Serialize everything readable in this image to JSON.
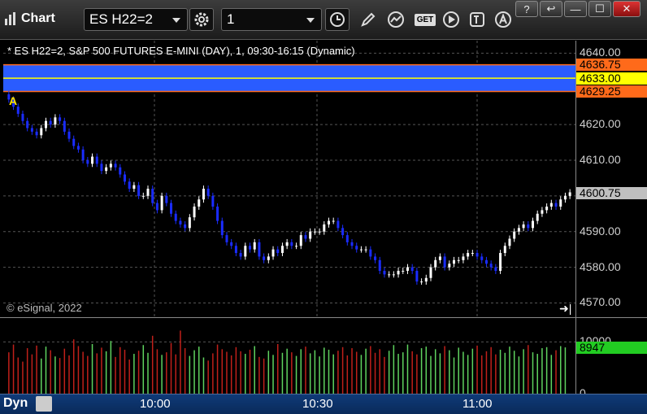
{
  "toolbar": {
    "app_title": "Chart",
    "symbol_value": "ES H22=2",
    "interval_value": "1",
    "buttons": [
      "settings-icon",
      "clock-icon",
      "pencil-icon",
      "study-icon",
      "get-icon",
      "play-icon",
      "text-tool-icon",
      "alert-icon"
    ],
    "get_label": "GET",
    "window_buttons": {
      "help": "?",
      "restore": "↩",
      "minimize": "—",
      "maximize": "☐",
      "close": "✕"
    }
  },
  "chart": {
    "title": "* ES H22=2, S&P 500 FUTURES E-MINI (DAY), 1, 09:30-16:15 (Dynamic)",
    "copyright": "© eSignal, 2022",
    "marker_text": "A",
    "goto_end_glyph": "➜|"
  },
  "price_axis": {
    "ticks": [
      "4640.00",
      "4620.00",
      "4610.00",
      "4600.00",
      "4590.00",
      "4580.00",
      "4570.00"
    ],
    "badges": {
      "upper": {
        "text": "4636.75",
        "color": "#ff6a1a"
      },
      "mid": {
        "text": "4633.00",
        "color": "#ffff00"
      },
      "lower": {
        "text": "4629.25",
        "color": "#ff6a1a"
      },
      "last": {
        "text": "4600.75",
        "color": "#bfbfbf"
      }
    }
  },
  "volume_axis": {
    "ticks": [
      "10000",
      "0"
    ],
    "last_volume": {
      "text": "8947",
      "color": "#22cc22"
    }
  },
  "time_axis": {
    "mode_label": "Dyn",
    "labels": [
      "10:00",
      "10:30",
      "11:00"
    ]
  },
  "colors": {
    "up_candle": "#ffffff",
    "down_candle": "#1a2cff",
    "band_fill": "#2a5cff",
    "band_edge": "#ff6a1a",
    "band_mid": "#ffff00",
    "volume_up": "#5fd35f",
    "volume_down": "#c0201a",
    "grid": "#555555"
  },
  "chart_data": {
    "type": "candlestick",
    "y_range": [
      4566.0,
      4643.5
    ],
    "price_levels": {
      "band_top": 4636.75,
      "band_mid": 4633.0,
      "band_bottom": 4629.25,
      "last": 4600.75
    },
    "closes": [
      4627,
      4625,
      4623,
      4621,
      4619,
      4618,
      4617,
      4619,
      4621,
      4620,
      4622,
      4621,
      4618,
      4616,
      4614,
      4613,
      4610,
      4609,
      4611,
      4609,
      4607,
      4608,
      4609,
      4608,
      4606,
      4604,
      4602,
      4603,
      4600,
      4600,
      4602,
      4598,
      4596,
      4600,
      4598,
      4595,
      4593,
      4592,
      4591,
      4594,
      4597,
      4599,
      4602,
      4600,
      4597,
      4593,
      4589,
      4587,
      4586,
      4584,
      4583,
      4586,
      4585,
      4587,
      4583,
      4582,
      4583,
      4585,
      4584,
      4586,
      4587,
      4586,
      4586,
      4589,
      4588,
      4590,
      4590,
      4590,
      4592,
      4593,
      4593,
      4591,
      4589,
      4587,
      4586,
      4585,
      4585,
      4585,
      4583,
      4582,
      4579,
      4578,
      4578,
      4578,
      4579,
      4579,
      4580,
      4579,
      4576,
      4576,
      4577,
      4580,
      4582,
      4583,
      4580,
      4581,
      4582,
      4582,
      4583,
      4584,
      4584,
      4583,
      4582,
      4581,
      4580,
      4579,
      4584,
      4586,
      4588,
      4590,
      4591,
      4592,
      4591,
      4593,
      4595,
      4596,
      4597,
      4598,
      4597,
      4599,
      4600,
      4601
    ],
    "volumes": [
      8000,
      9500,
      7000,
      6200,
      8800,
      7600,
      9300,
      6800,
      9100,
      8400,
      7200,
      6900,
      8700,
      7400,
      10500,
      9200,
      8100,
      7300,
      9600,
      7800,
      8900,
      8200,
      10200,
      7100,
      9000,
      8500,
      6600,
      7700,
      8300,
      9400,
      7900,
      11200,
      8600,
      7500,
      8000,
      9800,
      7600,
      12200,
      8800,
      7300,
      8400,
      9100,
      7000,
      6400,
      7800,
      9500,
      8600,
      8100,
      7400,
      9000,
      8200,
      7700,
      8500,
      9200,
      7100,
      6800,
      8300,
      7500,
      9600,
      7900,
      8700,
      8000,
      7300,
      8600,
      9100,
      7800,
      8400,
      7200,
      8900,
      8500,
      7600,
      8300,
      9000,
      7400,
      8800,
      8100,
      7500,
      8700,
      9200,
      7900,
      8600,
      7100,
      8300,
      9400,
      7700,
      8000,
      9500,
      8200,
      7600,
      8800,
      9100,
      7300,
      8600,
      7800,
      9200,
      8400,
      7000,
      8900,
      8100,
      7500,
      8700,
      9300,
      7400,
      8200,
      9000,
      7600,
      8500,
      7900,
      9100,
      8300,
      7200,
      8600,
      9400,
      8000,
      7700,
      8800,
      9000,
      7500,
      8400,
      9200,
      8947
    ]
  }
}
